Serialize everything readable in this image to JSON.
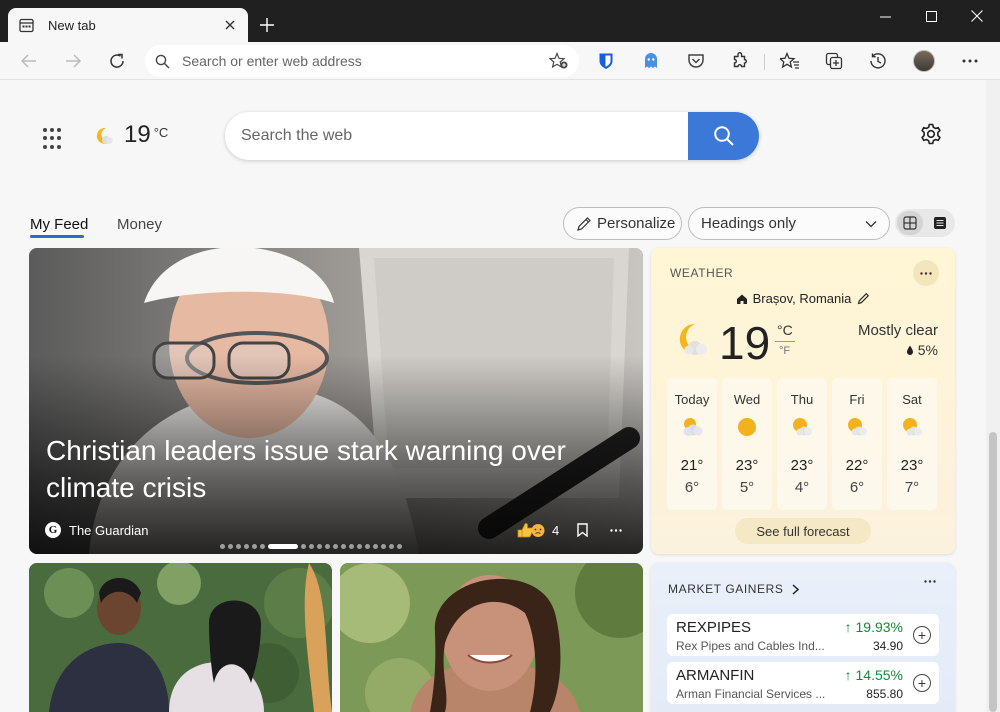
{
  "browser": {
    "tab_title": "New tab",
    "address_placeholder": "Search or enter web address"
  },
  "header": {
    "temperature": "19",
    "unit": "°C",
    "search_placeholder": "Search the web"
  },
  "feed": {
    "tabs": [
      {
        "label": "My Feed",
        "active": true
      },
      {
        "label": "Money",
        "active": false
      }
    ],
    "personalize_label": "Personalize",
    "layout_select": "Headings only"
  },
  "hero": {
    "title": "Christian leaders issue stark warning over climate crisis",
    "source": "The Guardian",
    "source_logo": "G",
    "reaction_count": "4",
    "slide_count": 20,
    "current_slide": 7
  },
  "weather": {
    "label": "WEATHER",
    "location": "Brașov, Romania",
    "temperature": "19",
    "unit_c": "°C",
    "unit_f": "°F",
    "condition": "Mostly clear",
    "precipitation": "5%",
    "forecast": [
      {
        "day": "Today",
        "high": "21°",
        "low": "6°",
        "icon": "partly-cloudy-icon"
      },
      {
        "day": "Wed",
        "high": "23°",
        "low": "5°",
        "icon": "sunny-icon"
      },
      {
        "day": "Thu",
        "high": "23°",
        "low": "4°",
        "icon": "partly-sunny-icon"
      },
      {
        "day": "Fri",
        "high": "22°",
        "low": "6°",
        "icon": "partly-sunny-icon"
      },
      {
        "day": "Sat",
        "high": "23°",
        "low": "7°",
        "icon": "partly-sunny-icon"
      }
    ],
    "full_forecast_label": "See full forecast"
  },
  "market": {
    "title": "MARKET GAINERS",
    "stocks": [
      {
        "symbol": "REXPIPES",
        "name": "Rex Pipes and Cables Ind...",
        "change": "↑ 19.93%",
        "price": "34.90"
      },
      {
        "symbol": "ARMANFIN",
        "name": "Arman Financial Services ...",
        "change": "↑ 14.55%",
        "price": "855.80"
      }
    ]
  },
  "colors": {
    "accent": "#3b78d8",
    "gain": "#128a3a",
    "titlebar": "#202020"
  }
}
